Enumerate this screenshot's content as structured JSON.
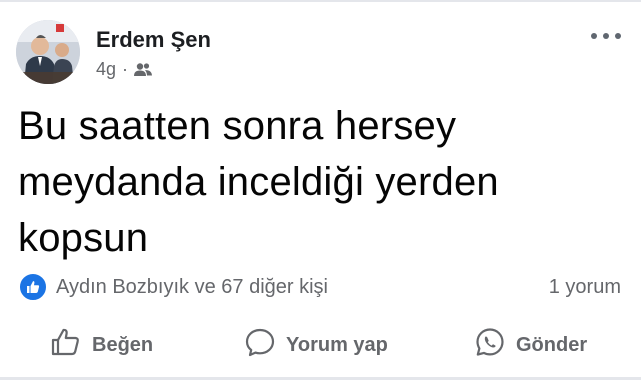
{
  "post": {
    "author": "Erdem Şen",
    "time": "4g",
    "dot": "·",
    "audience_icon": "friends-icon",
    "text": "Bu saatten sonra hersey\nmeydanda inceldiği yerden\nkopsun",
    "reactions_text": "Aydın Bozbıyık ve 67 diğer kişi",
    "comments_text": "1 yorum"
  },
  "actions": {
    "like": "Beğen",
    "comment": "Yorum yap",
    "send": "Gönder"
  },
  "colors": {
    "text": "#050505",
    "secondary": "#65676b",
    "like_blue": "#1b74e4",
    "divider": "#e4e6eb"
  }
}
